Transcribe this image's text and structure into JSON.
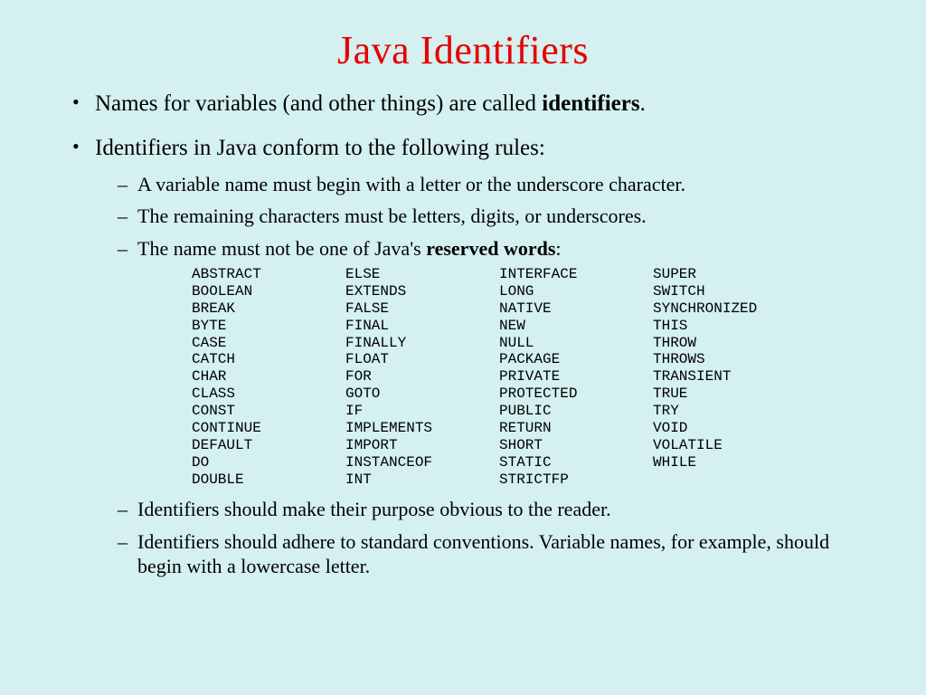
{
  "title": "Java Identifiers",
  "bullets": {
    "b1_pre": "Names for variables (and other things) are called ",
    "b1_bold": "identifiers",
    "b1_post": ".",
    "b2": "Identifiers in Java conform to the following rules:",
    "r1": "A variable name must begin with a letter or the underscore character.",
    "r2": "The remaining characters must be letters, digits, or underscores.",
    "r3_pre": "The name must not be one of Java's ",
    "r3_bold": "reserved words",
    "r3_post": ":",
    "r4": "Identifiers should make their purpose obvious to the reader.",
    "r5": "Identifiers should adhere to standard conventions.  Variable names, for example, should begin with a lowercase letter."
  },
  "keywords": {
    "col1": [
      "abstract",
      "boolean",
      "break",
      "byte",
      "case",
      "catch",
      "char",
      "class",
      "const",
      "continue",
      "default",
      "do",
      "double"
    ],
    "col2": [
      "else",
      "extends",
      "false",
      "final",
      "finally",
      "float",
      "for",
      "goto",
      "if",
      "implements",
      "import",
      "instanceof",
      "int"
    ],
    "col3": [
      "interface",
      "long",
      "native",
      "new",
      "null",
      "package",
      "private",
      "protected",
      "public",
      "return",
      "short",
      "static",
      "strictfp"
    ],
    "col4": [
      "super",
      "switch",
      "synchronized",
      "this",
      "throw",
      "throws",
      "transient",
      "true",
      "try",
      "void",
      "volatile",
      "while"
    ]
  }
}
